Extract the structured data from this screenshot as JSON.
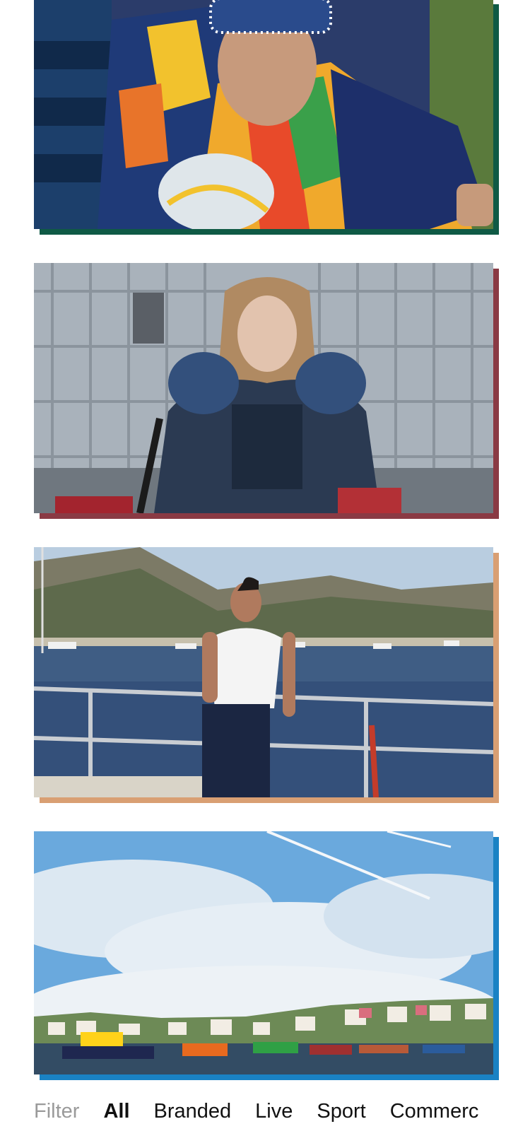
{
  "cards": [
    {
      "name": "rugby-player-photo",
      "accent": "#0f5a45"
    },
    {
      "name": "hockey-player-photo",
      "accent": "#8a3a44"
    },
    {
      "name": "harbour-man-photo",
      "accent": "#d99f73"
    },
    {
      "name": "harbour-town-photo",
      "accent": "#1a82c4"
    }
  ],
  "filter": {
    "label": "Filter",
    "items": [
      "All",
      "Branded",
      "Live",
      "Sport",
      "Commerc"
    ],
    "active": "All"
  }
}
